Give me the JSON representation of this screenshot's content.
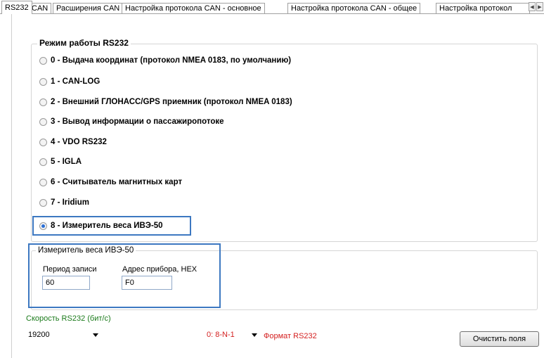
{
  "tabs": [
    {
      "label": "RS232",
      "active": true
    },
    {
      "label": "CAN"
    },
    {
      "label": "Расширения CAN"
    },
    {
      "label": "Настройка протокола CAN - основное"
    },
    {
      "label": "Настройка протокола CAN - общее"
    },
    {
      "label": "Настройка протокол"
    }
  ],
  "mode_group": {
    "title": "Режим работы RS232",
    "options": [
      {
        "label": "0 - Выдача координат (протокол NMEA 0183, по умолчанию)",
        "checked": false
      },
      {
        "label": "1 - CAN-LOG",
        "checked": false
      },
      {
        "label": "2 - Внешний ГЛОНАСС/GPS приемник (протокол NMEA 0183)",
        "checked": false
      },
      {
        "label": "3 - Вывод информации о пассажиропотоке",
        "checked": false
      },
      {
        "label": "4 - VDO RS232",
        "checked": false
      },
      {
        "label": "5 - IGLA",
        "checked": false
      },
      {
        "label": "6 - Считыватель магнитных карт",
        "checked": false
      },
      {
        "label": "7 - Iridium",
        "checked": false
      },
      {
        "label": "8 - Измеритель веса ИВЭ-50",
        "checked": true
      }
    ]
  },
  "device_group": {
    "title": "Измеритель веса ИВЭ-50",
    "period_label": "Период записи",
    "period_value": "60",
    "address_label": "Адрес прибора, HEX",
    "address_value": "F0"
  },
  "speed": {
    "label": "Скорость RS232 (бит/с)",
    "value": "19200"
  },
  "format": {
    "value": "0: 8-N-1",
    "label": "Формат RS232"
  },
  "clear_button": "Очистить поля",
  "colors": {
    "accent": "#3d78c1",
    "speed_label": "#1a7a1a",
    "format_red": "#d42020"
  }
}
